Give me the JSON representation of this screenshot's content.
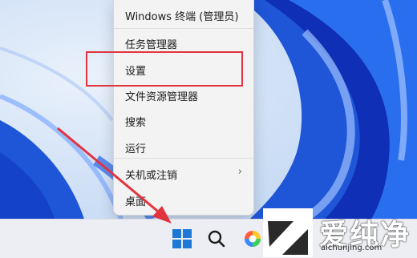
{
  "context_menu": {
    "items": [
      {
        "label": "Windows 终端 (管理员)",
        "submenu": false
      },
      {
        "label": "任务管理器",
        "submenu": false
      },
      {
        "label": "设置",
        "submenu": false,
        "highlighted": true
      },
      {
        "label": "文件资源管理器",
        "submenu": false
      },
      {
        "label": "搜索",
        "submenu": false
      },
      {
        "label": "运行",
        "submenu": false
      },
      {
        "label": "关机或注销",
        "submenu": true,
        "chevron": "›"
      },
      {
        "label": "桌面",
        "submenu": false
      }
    ]
  },
  "taskbar": {
    "icons": [
      "windows-start-icon",
      "search-icon",
      "color-app-icon"
    ]
  },
  "watermark": {
    "title": "爱纯净",
    "url": "aichunjing.com"
  },
  "colors": {
    "highlight_border": "#e2343f",
    "arrow": "#e2343f",
    "start_blue": "#1d78d6",
    "wallpaper_blue": "#1f56d8"
  }
}
